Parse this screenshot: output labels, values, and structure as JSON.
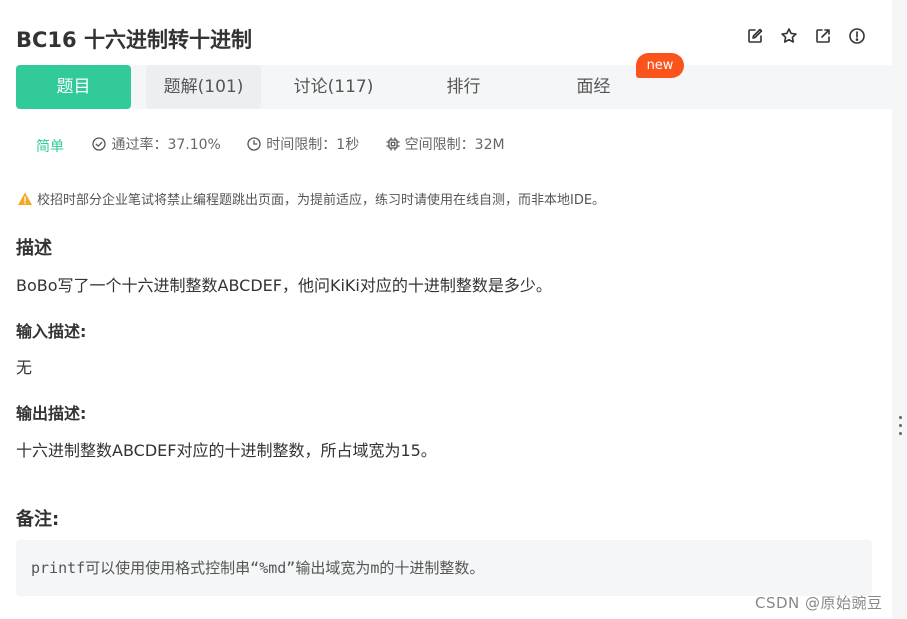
{
  "problem": {
    "title": "BC16  十六进制转十进制"
  },
  "title_icons": [
    "edit-icon",
    "star-icon",
    "share-icon",
    "info-icon"
  ],
  "tabs": [
    {
      "label": "题目",
      "active": true
    },
    {
      "label": "题解(101)",
      "active": false
    },
    {
      "label": "讨论(117)",
      "active": false
    },
    {
      "label": "排行",
      "active": false
    },
    {
      "label": "面经",
      "active": false,
      "badge": "new"
    }
  ],
  "meta": {
    "difficulty": "简单",
    "pass_rate": "通过率：37.10%",
    "time_limit": "时间限制：1秒",
    "memory_limit": "空间限制：32M"
  },
  "notice": "校招时部分企业笔试将禁止编程题跳出页面，为提前适应，练习时请使用在线自测，而非本地IDE。",
  "sections": {
    "desc_title": "描述",
    "desc_text": "BoBo写了一个十六进制整数ABCDEF，他问KiKi对应的十进制整数是多少。",
    "input_title": "输入描述:",
    "input_text": "无",
    "output_title": "输出描述:",
    "output_text": "十六进制整数ABCDEF对应的十进制整数，所占域宽为15。",
    "note_title": "备注:",
    "note_code": "printf可以使用使用格式控制串“%md”输出域宽为m的十进制整数。"
  },
  "watermark": "CSDN @原始豌豆",
  "colors": {
    "accent": "#32ca99",
    "badge": "#fa541c"
  }
}
